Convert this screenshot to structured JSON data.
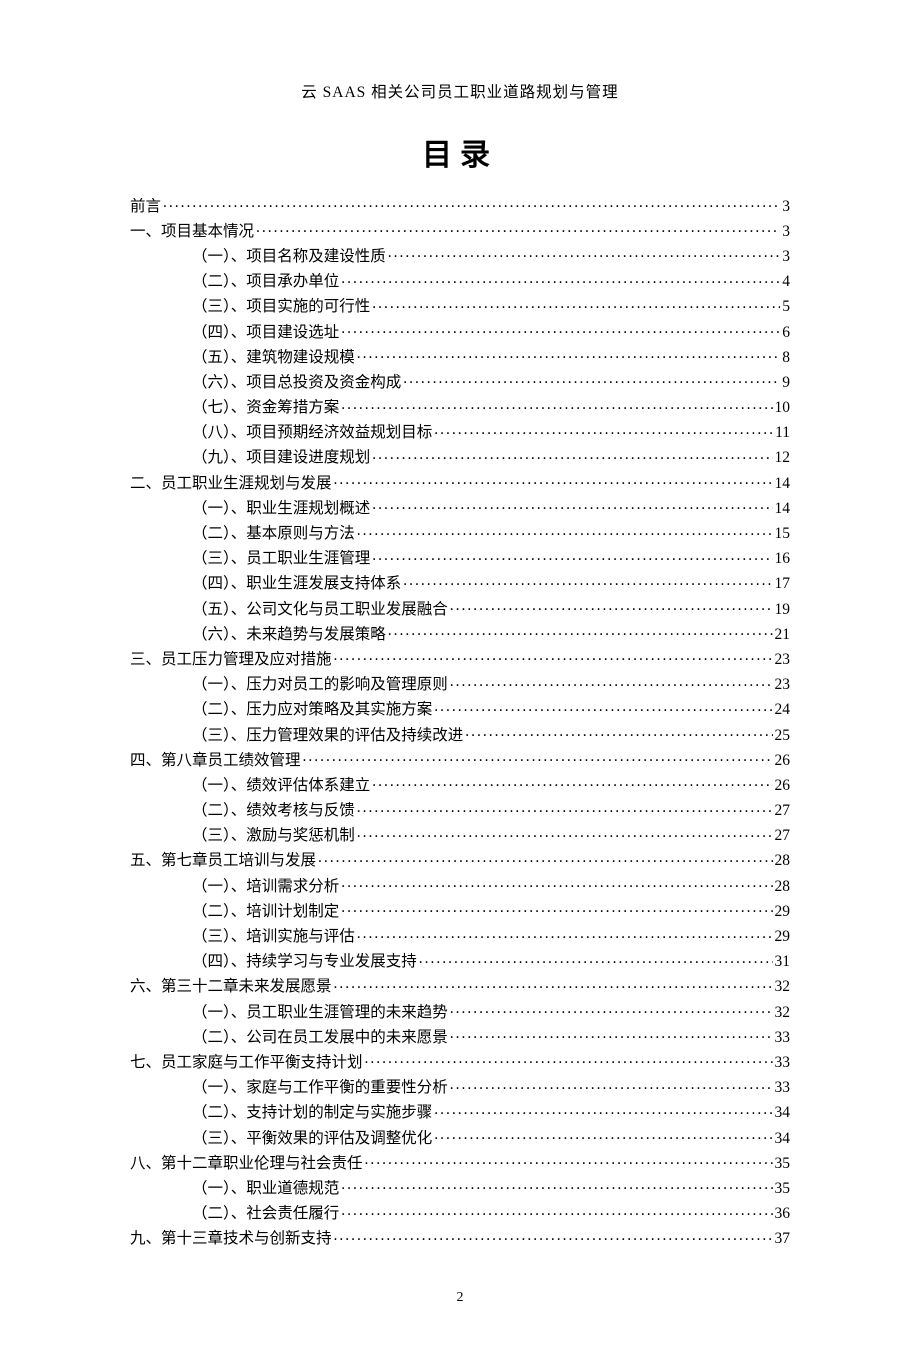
{
  "header": "云 SAAS 相关公司员工职业道路规划与管理",
  "title": "目录",
  "page_number": "2",
  "toc": [
    {
      "level": 0,
      "label": "前言",
      "page": "3"
    },
    {
      "level": 0,
      "label": "一、项目基本情况",
      "page": "3"
    },
    {
      "level": 1,
      "label": "（一）、项目名称及建设性质",
      "page": "3"
    },
    {
      "level": 1,
      "label": "（二）、项目承办单位",
      "page": "4"
    },
    {
      "level": 1,
      "label": "（三）、项目实施的可行性",
      "page": "5"
    },
    {
      "level": 1,
      "label": "（四）、项目建设选址",
      "page": "6"
    },
    {
      "level": 1,
      "label": "（五）、建筑物建设规模",
      "page": "8"
    },
    {
      "level": 1,
      "label": "（六）、项目总投资及资金构成",
      "page": "9"
    },
    {
      "level": 1,
      "label": "（七）、资金筹措方案",
      "page": "10"
    },
    {
      "level": 1,
      "label": "（八）、项目预期经济效益规划目标",
      "page": "11"
    },
    {
      "level": 1,
      "label": "（九）、项目建设进度规划",
      "page": "12"
    },
    {
      "level": 0,
      "label": "二、员工职业生涯规划与发展",
      "page": "14"
    },
    {
      "level": 1,
      "label": "（一）、职业生涯规划概述",
      "page": "14"
    },
    {
      "level": 1,
      "label": "（二）、基本原则与方法",
      "page": "15"
    },
    {
      "level": 1,
      "label": "（三）、员工职业生涯管理",
      "page": "16"
    },
    {
      "level": 1,
      "label": "（四）、职业生涯发展支持体系",
      "page": "17"
    },
    {
      "level": 1,
      "label": "（五）、公司文化与员工职业发展融合",
      "page": "19"
    },
    {
      "level": 1,
      "label": "（六）、未来趋势与发展策略",
      "page": "21"
    },
    {
      "level": 0,
      "label": "三、员工压力管理及应对措施",
      "page": "23"
    },
    {
      "level": 1,
      "label": "（一）、压力对员工的影响及管理原则",
      "page": "23"
    },
    {
      "level": 1,
      "label": "（二）、压力应对策略及其实施方案",
      "page": "24"
    },
    {
      "level": 1,
      "label": "（三）、压力管理效果的评估及持续改进",
      "page": "25"
    },
    {
      "level": 0,
      "label": "四、第八章员工绩效管理",
      "page": "26"
    },
    {
      "level": 1,
      "label": "（一）、绩效评估体系建立",
      "page": "26"
    },
    {
      "level": 1,
      "label": "（二）、绩效考核与反馈",
      "page": "27"
    },
    {
      "level": 1,
      "label": "（三）、激励与奖惩机制",
      "page": "27"
    },
    {
      "level": 0,
      "label": "五、第七章员工培训与发展",
      "page": "28"
    },
    {
      "level": 1,
      "label": "（一）、培训需求分析",
      "page": "28"
    },
    {
      "level": 1,
      "label": "（二）、培训计划制定",
      "page": "29"
    },
    {
      "level": 1,
      "label": "（三）、培训实施与评估",
      "page": "29"
    },
    {
      "level": 1,
      "label": "（四）、持续学习与专业发展支持",
      "page": "31"
    },
    {
      "level": 0,
      "label": "六、第三十二章未来发展愿景",
      "page": "32"
    },
    {
      "level": 1,
      "label": "（一）、员工职业生涯管理的未来趋势",
      "page": "32"
    },
    {
      "level": 1,
      "label": "（二）、公司在员工发展中的未来愿景",
      "page": "33"
    },
    {
      "level": 0,
      "label": "七、员工家庭与工作平衡支持计划",
      "page": "33"
    },
    {
      "level": 1,
      "label": "（一）、家庭与工作平衡的重要性分析",
      "page": "33"
    },
    {
      "level": 1,
      "label": "（二）、支持计划的制定与实施步骤",
      "page": "34"
    },
    {
      "level": 1,
      "label": "（三）、平衡效果的评估及调整优化",
      "page": "34"
    },
    {
      "level": 0,
      "label": "八、第十二章职业伦理与社会责任",
      "page": "35"
    },
    {
      "level": 1,
      "label": "（一）、职业道德规范",
      "page": "35"
    },
    {
      "level": 1,
      "label": "（二）、社会责任履行",
      "page": "36"
    },
    {
      "level": 0,
      "label": "九、第十三章技术与创新支持",
      "page": "37"
    }
  ]
}
